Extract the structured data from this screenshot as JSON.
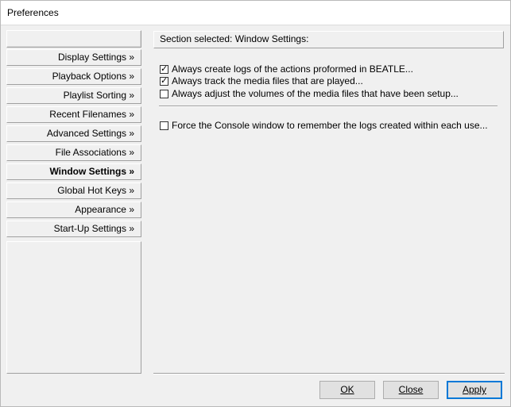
{
  "window": {
    "title": "Preferences"
  },
  "sidebar": {
    "items": [
      {
        "label": "Display Settings »",
        "active": false
      },
      {
        "label": "Playback Options »",
        "active": false
      },
      {
        "label": "Playlist Sorting »",
        "active": false
      },
      {
        "label": "Recent Filenames »",
        "active": false
      },
      {
        "label": "Advanced Settings »",
        "active": false
      },
      {
        "label": "File Associations »",
        "active": false
      },
      {
        "label": "Window Settings »",
        "active": true
      },
      {
        "label": "Global Hot Keys »",
        "active": false
      },
      {
        "label": "Appearance »",
        "active": false
      },
      {
        "label": "Start-Up Settings »",
        "active": false
      }
    ]
  },
  "section": {
    "header": "Section selected:  Window Settings:"
  },
  "options": [
    {
      "label": "Always create logs of the actions proformed in BEATLE...",
      "checked": true
    },
    {
      "label": "Always track the media files that are played...",
      "checked": true
    },
    {
      "label": "Always adjust the volumes of the media files that have been setup...",
      "checked": false
    },
    {
      "label": "Force the Console window to remember the logs created within each use...",
      "checked": false
    }
  ],
  "buttons": {
    "ok": "OK",
    "close": "Close",
    "apply": "Apply"
  }
}
